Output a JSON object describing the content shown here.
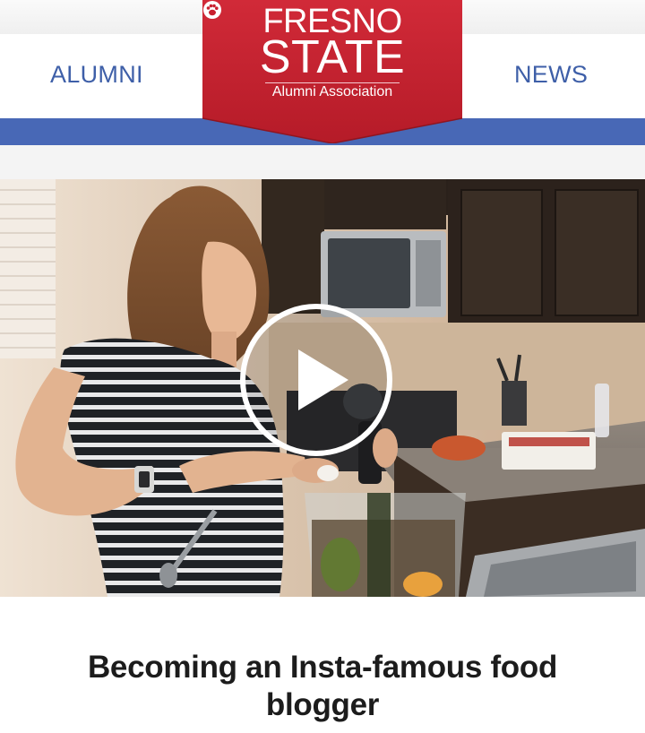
{
  "nav": {
    "left_label": "ALUMNI",
    "right_label": "NEWS"
  },
  "logo": {
    "line1": "FRESNO",
    "line2": "STATE",
    "subtitle": "Alumni Association",
    "icon": "paw-icon"
  },
  "hero": {
    "play_icon": "play-icon"
  },
  "article": {
    "title": "Becoming an Insta-famous food blogger"
  },
  "colors": {
    "brand_red": "#c8202f",
    "brand_blue": "#4868b6",
    "nav_text": "#3e5fa8"
  }
}
